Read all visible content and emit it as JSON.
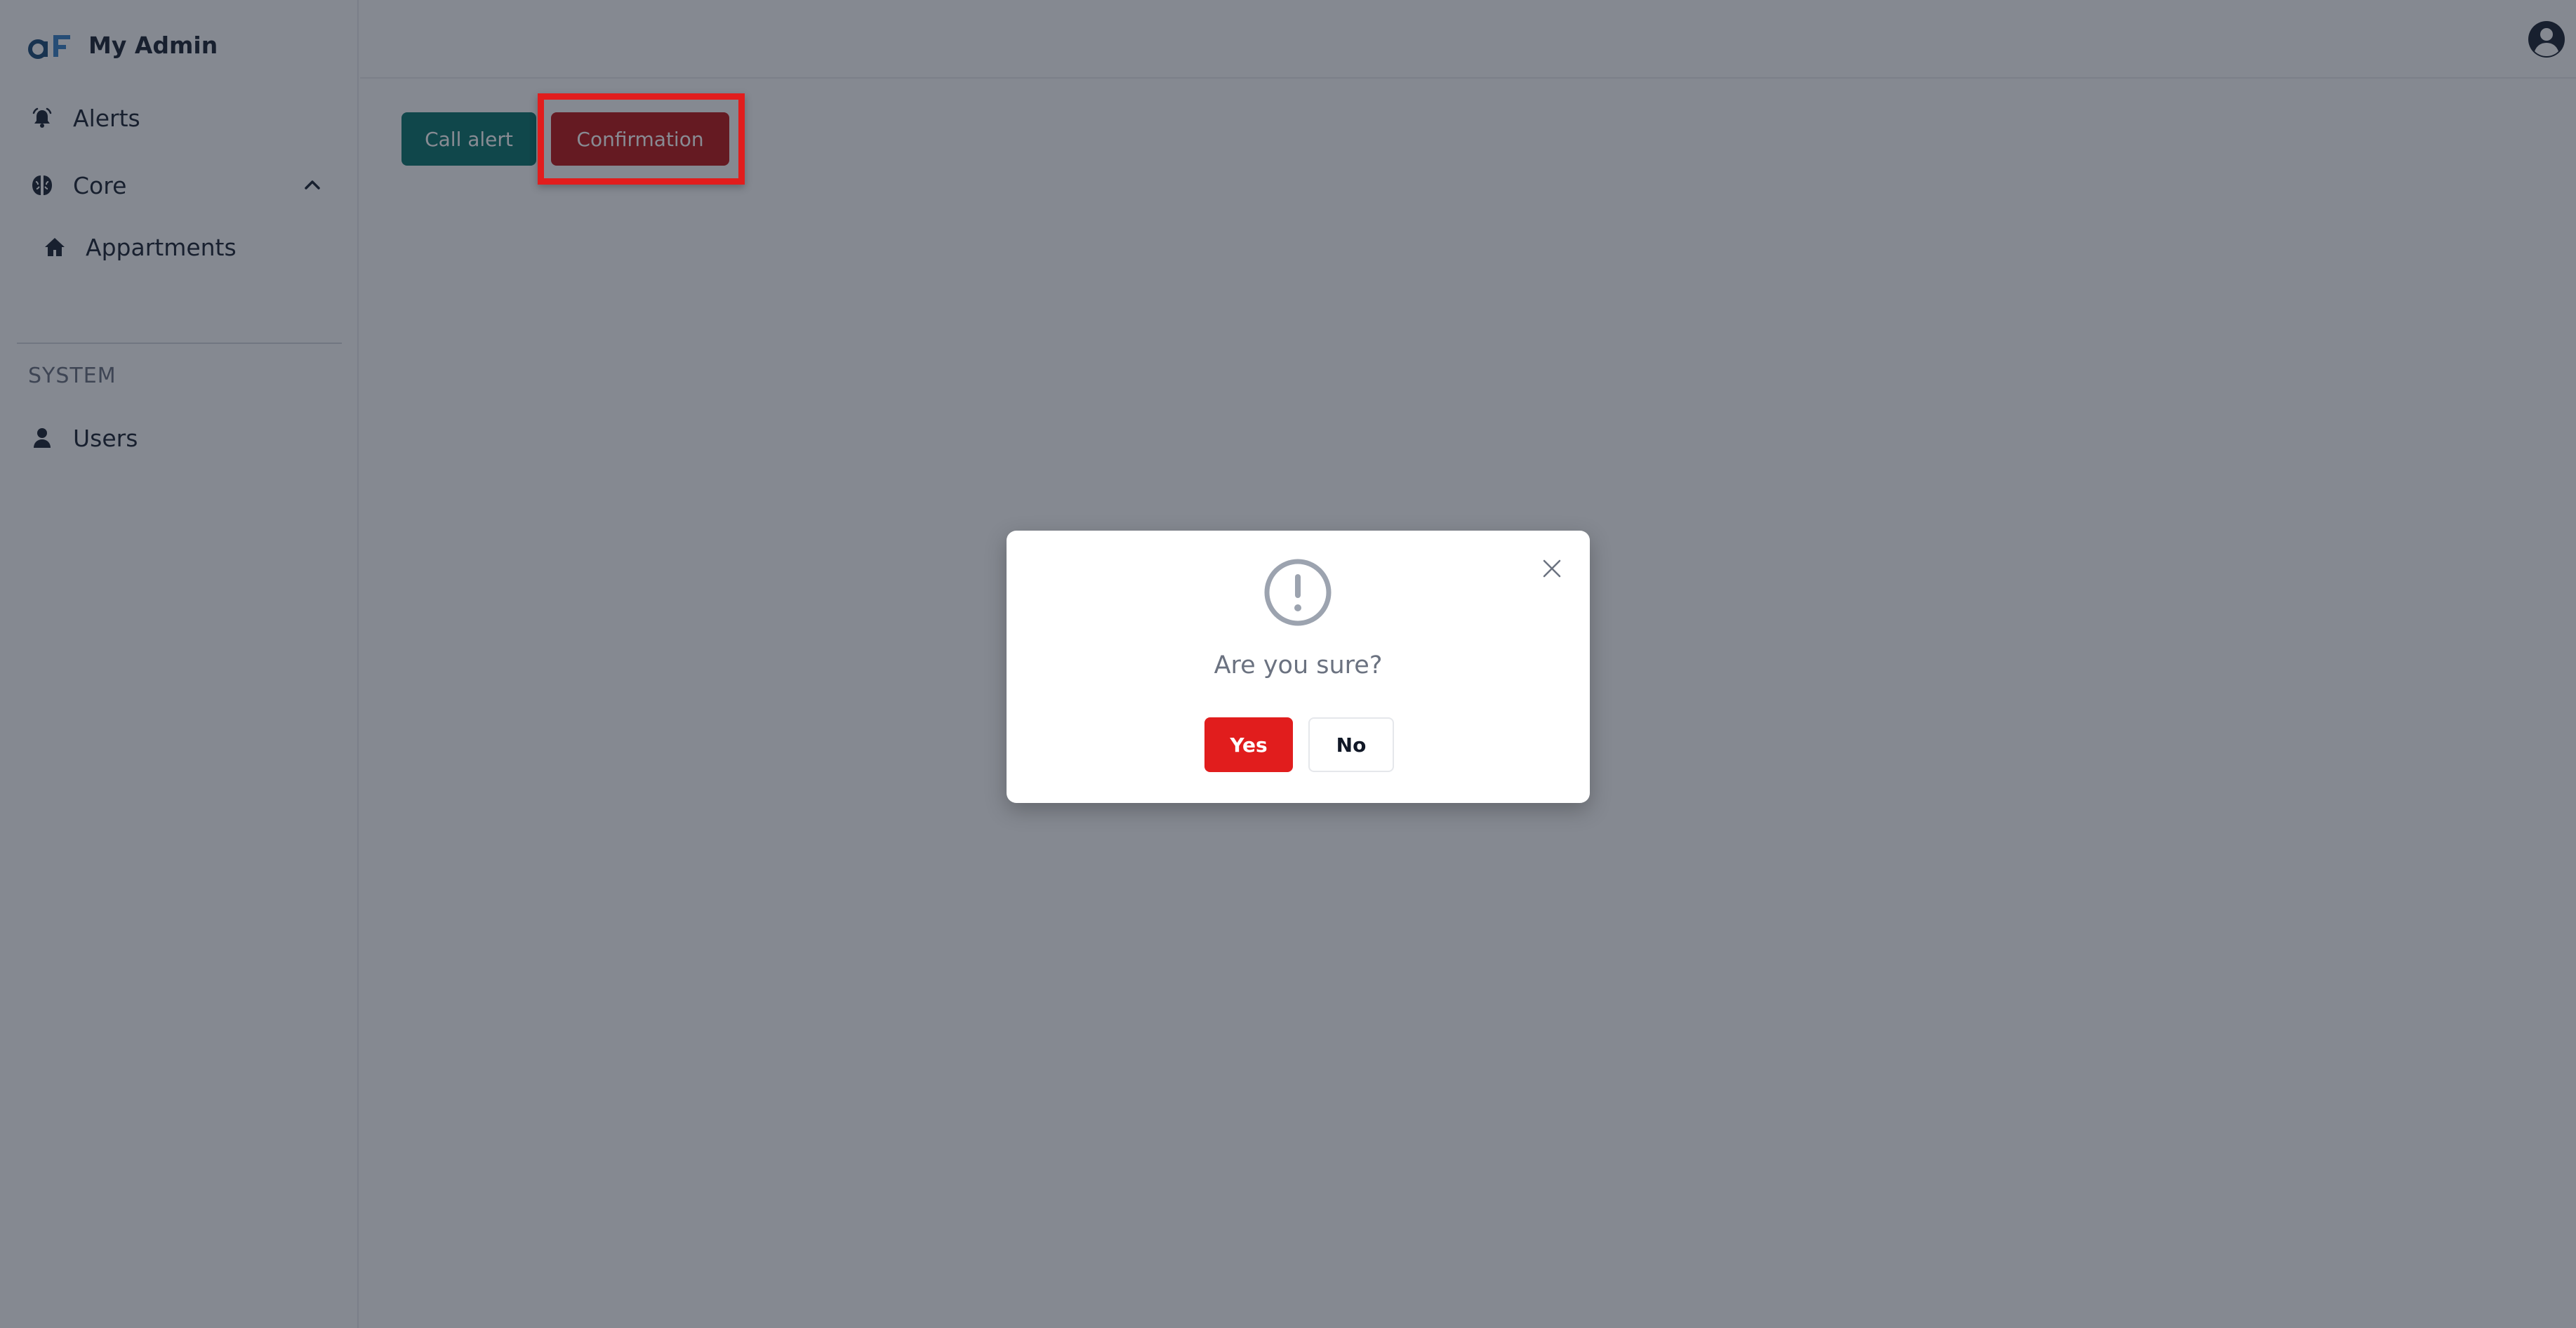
{
  "app": {
    "title": "My Admin"
  },
  "sidebar": {
    "items": [
      {
        "label": "Alerts",
        "icon": "bell-ring-icon"
      },
      {
        "label": "Core",
        "icon": "brain-icon",
        "expanded": true
      },
      {
        "label": "Appartments",
        "icon": "home-icon"
      }
    ],
    "section_label": "SYSTEM",
    "system_items": [
      {
        "label": "Users",
        "icon": "user-icon"
      }
    ]
  },
  "header": {
    "avatar_icon": "user-circle-icon"
  },
  "main": {
    "call_alert_label": "Call alert",
    "confirmation_label": "Confirmation"
  },
  "modal": {
    "icon": "exclamation-circle-icon",
    "message": "Are you sure?",
    "yes_label": "Yes",
    "no_label": "No"
  },
  "colors": {
    "accent_green": "#0f766e",
    "accent_red": "#b91c1c",
    "danger": "#e11d1d",
    "highlight": "#e11d1d"
  }
}
